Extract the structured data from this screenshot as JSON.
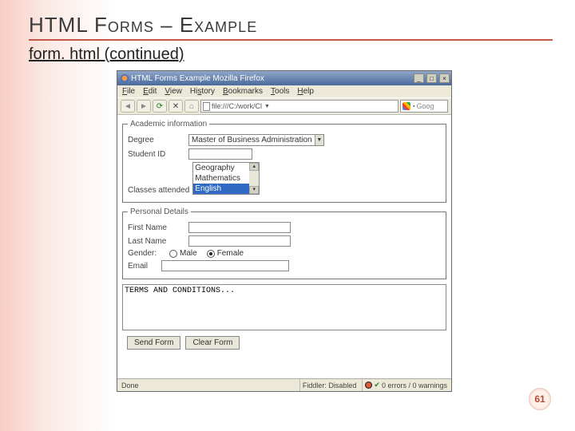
{
  "slide": {
    "title": "HTML Forms – Example",
    "subtitle": "form. html (continued)",
    "page_number": "61"
  },
  "browser": {
    "window_title": "HTML Forms Example   Mozilla Firefox",
    "menu": [
      "File",
      "Edit",
      "View",
      "History",
      "Bookmarks",
      "Tools",
      "Help"
    ],
    "url": "file:///C:/work/Cl",
    "search_placeholder": "Goog",
    "status_done": "Done",
    "status_fiddler": "Fiddler: Disabled",
    "status_errors": "0 errors / 0 warnings"
  },
  "form": {
    "fs1_legend": "Academic information",
    "degree_label": "Degree",
    "degree_value": "Master of Business Administration",
    "studentid_label": "Student ID",
    "classes_attended_label": "Classes attended",
    "classes": [
      "Geography",
      "Mathematics",
      "English"
    ],
    "classes_selected": "English",
    "fs2_legend": "Personal Details",
    "first_name": "First Name",
    "last_name": "Last Name",
    "gender_label": "Gender:",
    "gender_male": "Male",
    "gender_female": "Female",
    "gender_checked": "female",
    "email_label": "Email",
    "terms": "TERMS AND CONDITIONS...",
    "btn_send": "Send Form",
    "btn_clear": "Clear Form"
  }
}
